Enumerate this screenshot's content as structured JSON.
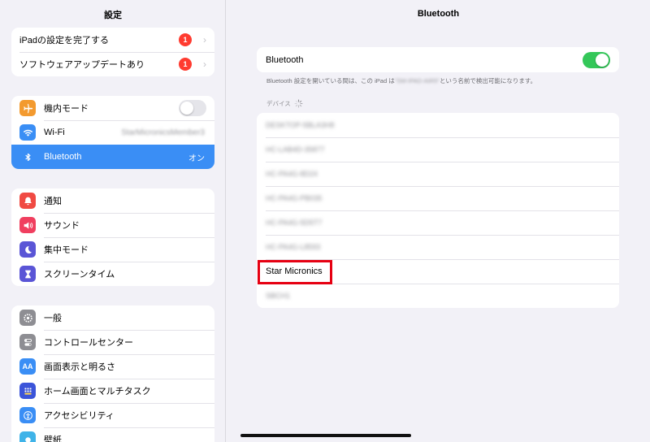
{
  "sidebar": {
    "title": "設定",
    "group1": [
      {
        "label": "iPadの設定を完了する",
        "badge": "1"
      },
      {
        "label": "ソフトウェアアップデートあり",
        "badge": "1"
      }
    ],
    "group2": [
      {
        "label": "機内モード",
        "icon": "airplane-icon",
        "color": "#f39a2f"
      },
      {
        "label": "Wi-Fi",
        "icon": "wifi-icon",
        "color": "#3a8ef5",
        "value": "StarMicronicsMember3"
      },
      {
        "label": "Bluetooth",
        "icon": "bluetooth-icon",
        "color": "#3a8ef5",
        "value": "オン"
      }
    ],
    "group3": [
      {
        "label": "通知",
        "icon": "bell-icon",
        "color": "#f04a43"
      },
      {
        "label": "サウンド",
        "icon": "speaker-icon",
        "color": "#f03f5f"
      },
      {
        "label": "集中モード",
        "icon": "moon-icon",
        "color": "#5a55d6"
      },
      {
        "label": "スクリーンタイム",
        "icon": "hourglass-icon",
        "color": "#5a55d6"
      }
    ],
    "group4": [
      {
        "label": "一般",
        "icon": "gear-icon",
        "color": "#8e8e93"
      },
      {
        "label": "コントロールセンター",
        "icon": "switches-icon",
        "color": "#8e8e93"
      },
      {
        "label": "画面表示と明るさ",
        "icon": "text-size-icon",
        "color": "#3a8ef5",
        "glyph": "AA"
      },
      {
        "label": "ホーム画面とマルチタスク",
        "icon": "home-grid-icon",
        "color": "#3b54d9"
      },
      {
        "label": "アクセシビリティ",
        "icon": "accessibility-icon",
        "color": "#3a8ef5"
      },
      {
        "label": "壁紙",
        "icon": "wallpaper-icon",
        "color": "#3fb3e8"
      }
    ]
  },
  "main": {
    "title": "Bluetooth",
    "toggle_label": "Bluetooth",
    "toggle_state": "on",
    "desc_prefix": "Bluetooth 設定を開いている間は、この iPad は",
    "desc_blurred": "\"SM-IPAD-AIR5\"",
    "desc_suffix": "という名前で検出可能になります。",
    "devices_header": "デバイス",
    "devices": [
      {
        "name": "DESKTOP-5BLA3H8",
        "blurred": true
      },
      {
        "name": "HC-LAB4D-35877",
        "blurred": true
      },
      {
        "name": "HC-PA4G-8D24",
        "blurred": true
      },
      {
        "name": "HC-PA4G-PB035",
        "blurred": true
      },
      {
        "name": "HC-PA4G-5D5T7",
        "blurred": true
      },
      {
        "name": "HC-PA4G-L8593",
        "blurred": true
      },
      {
        "name": "Star Micronics",
        "blurred": false
      },
      {
        "name": "SBCH1",
        "blurred": true
      }
    ]
  },
  "colors": {
    "accent": "#3a8ef5",
    "toggle_on": "#34c759",
    "badge": "#ff3b30",
    "highlight": "#e60012"
  }
}
